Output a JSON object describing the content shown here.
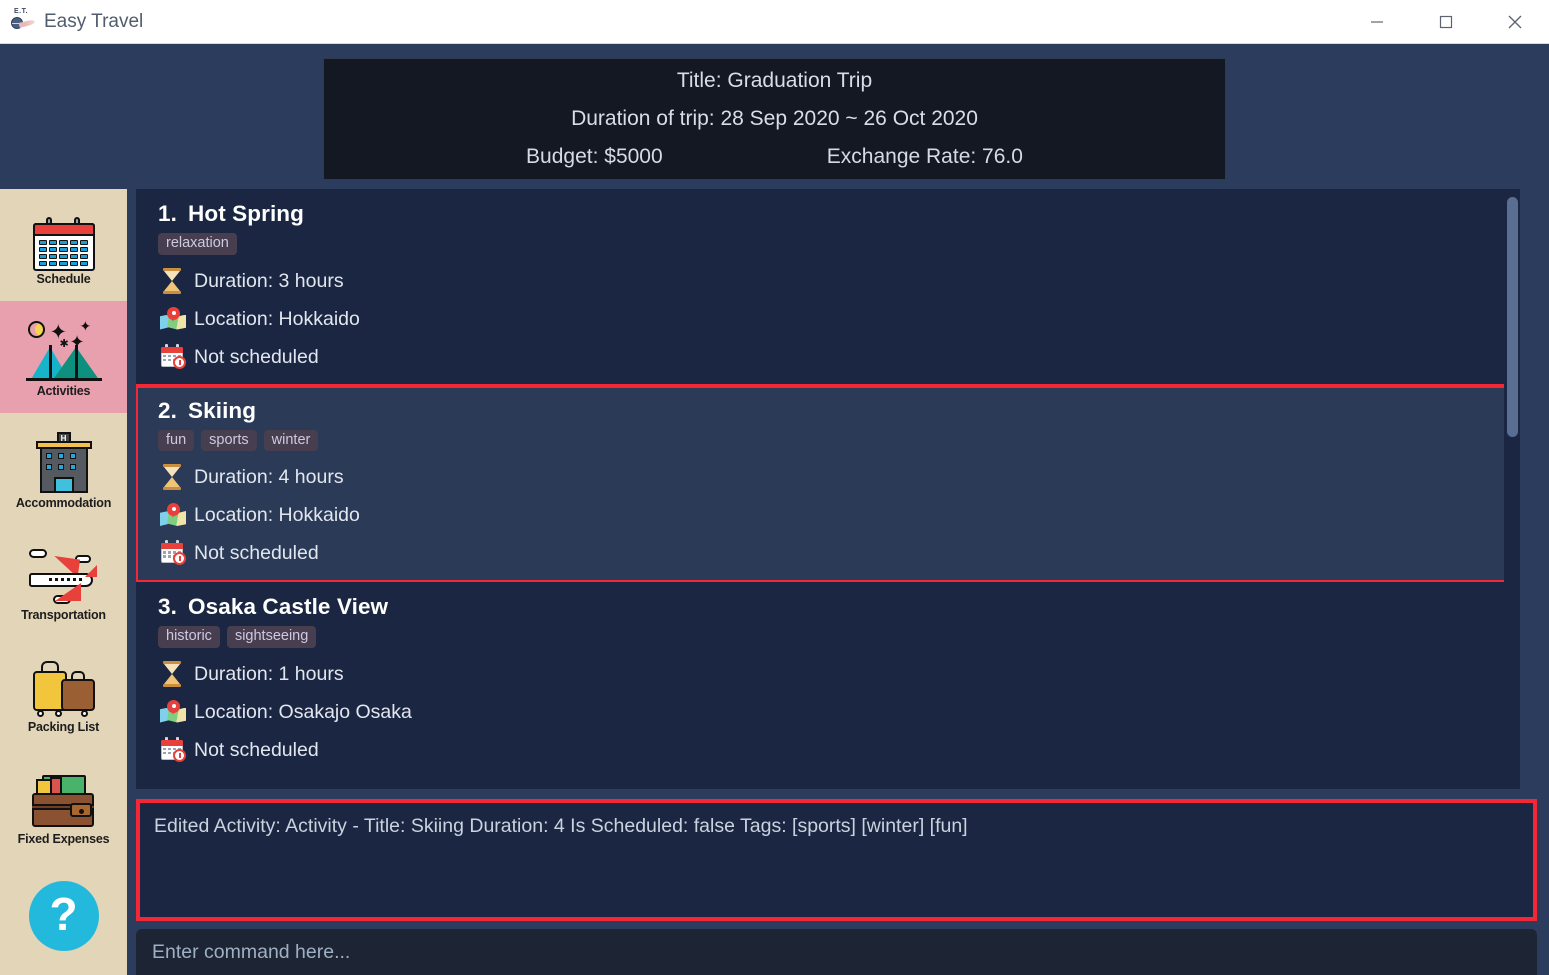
{
  "window": {
    "title": "Easy Travel",
    "logo_icon": "easy-travel-logo-icon",
    "minimize_label": "—",
    "maximize_label": "□",
    "close_label": "✕"
  },
  "header": {
    "title_line": "Title: Graduation Trip",
    "duration_line": "Duration of trip: 28 Sep 2020 ~ 26 Oct 2020",
    "budget": "Budget: $5000",
    "exchange_rate": "Exchange Rate: 76.0"
  },
  "sidebar": {
    "items": [
      {
        "label": "Schedule",
        "icon": "calendar-icon",
        "active": false
      },
      {
        "label": "Activities",
        "icon": "tent-icon",
        "active": true
      },
      {
        "label": "Accommodation",
        "icon": "hotel-icon",
        "active": false
      },
      {
        "label": "Transportation",
        "icon": "airplane-icon",
        "active": false
      },
      {
        "label": "Packing List",
        "icon": "luggage-icon",
        "active": false
      },
      {
        "label": "Fixed Expenses",
        "icon": "wallet-icon",
        "active": false
      }
    ],
    "help_label": "?"
  },
  "activities": [
    {
      "number": "1.",
      "title": "Hot Spring",
      "tags": [
        "relaxation"
      ],
      "duration": "Duration: 3 hours",
      "location": "Location: Hokkaido",
      "schedule": "Not scheduled",
      "selected": false,
      "annotated": false
    },
    {
      "number": "2.",
      "title": "Skiing",
      "tags": [
        "fun",
        "sports",
        "winter"
      ],
      "duration": "Duration: 4 hours",
      "location": "Location: Hokkaido",
      "schedule": "Not scheduled",
      "selected": true,
      "annotated": true
    },
    {
      "number": "3.",
      "title": "Osaka Castle View",
      "tags": [
        "historic",
        "sightseeing"
      ],
      "duration": "Duration: 1 hours",
      "location": "Location: Osakajo Osaka",
      "schedule": "Not scheduled",
      "selected": false,
      "annotated": false
    }
  ],
  "console": {
    "output": "Edited Activity: Activity - Title: Skiing Duration: 4 Is Scheduled: false Tags: [sports] [winter] [fun]"
  },
  "command": {
    "placeholder": "Enter command here..."
  },
  "colors": {
    "window_bg": "#2b3c5c",
    "panel_bg": "#1b2742",
    "header_bg": "#141823",
    "sidebar_bg": "#e3d5b8",
    "sidebar_active": "#e8a0ae",
    "annotation_red": "#f32735",
    "selected_row": "#2a3a57",
    "tag_bg": "#473f4f",
    "help_cyan": "#23b9dd"
  }
}
